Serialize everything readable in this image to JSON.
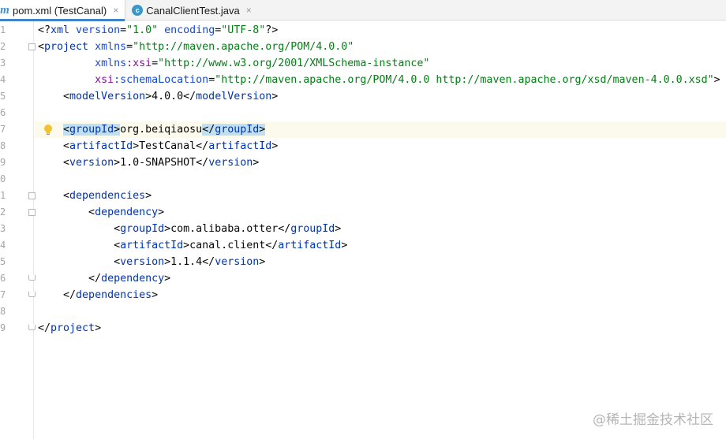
{
  "tabs": [
    {
      "label": "pom.xml (TestCanal)",
      "icon": "maven-file-icon",
      "close": "×",
      "active": true
    },
    {
      "label": "CanalClientTest.java",
      "icon": "java-class-icon",
      "close": "×",
      "active": false
    }
  ],
  "line_numbers": [
    "1",
    "2",
    "3",
    "4",
    "5",
    "6",
    "7",
    "8",
    "9",
    "0",
    "1",
    "2",
    "3",
    "4",
    "5",
    "6",
    "7",
    "8",
    "9"
  ],
  "code_lines": [
    {
      "tokens": [
        [
          "t-bracket",
          "<?"
        ],
        [
          "t-tag",
          "xml "
        ],
        [
          "t-attr",
          "version"
        ],
        [
          "t-bracket",
          "="
        ],
        [
          "t-val",
          "\"1.0\""
        ],
        [
          "t-bracket",
          " "
        ],
        [
          "t-attr",
          "encoding"
        ],
        [
          "t-bracket",
          "="
        ],
        [
          "t-val",
          "\"UTF-8\""
        ],
        [
          "t-bracket",
          "?>"
        ]
      ]
    },
    {
      "tokens": [
        [
          "t-bracket",
          "<"
        ],
        [
          "t-tag",
          "project "
        ],
        [
          "t-attr",
          "xmlns"
        ],
        [
          "t-bracket",
          "="
        ],
        [
          "t-val",
          "\"http://maven.apache.org/POM/4.0.0\""
        ]
      ]
    },
    {
      "tokens": [
        [
          "t-bracket",
          "         "
        ],
        [
          "t-attr",
          "xmlns"
        ],
        [
          "t-ns",
          ":xsi"
        ],
        [
          "t-bracket",
          "="
        ],
        [
          "t-val",
          "\"http://www.w3.org/2001/XMLSchema-instance\""
        ]
      ]
    },
    {
      "tokens": [
        [
          "t-bracket",
          "         "
        ],
        [
          "t-ns",
          "xsi"
        ],
        [
          "t-attr",
          ":schemaLocation"
        ],
        [
          "t-bracket",
          "="
        ],
        [
          "t-val",
          "\"http://maven.apache.org/POM/4.0.0 http://maven.apache.org/xsd/maven-4.0.0.xsd\""
        ],
        [
          "t-bracket",
          ">"
        ]
      ]
    },
    {
      "tokens": [
        [
          "t-bracket",
          "    <"
        ],
        [
          "t-tag",
          "modelVersion"
        ],
        [
          "t-bracket",
          ">"
        ],
        [
          "t-text",
          "4.0.0"
        ],
        [
          "t-bracket",
          "</"
        ],
        [
          "t-tag",
          "modelVersion"
        ],
        [
          "t-bracket",
          ">"
        ]
      ]
    },
    {
      "tokens": []
    },
    {
      "tokens": [
        [
          "t-bracket",
          "    "
        ],
        [
          "t-hl",
          "<"
        ],
        [
          "t-tag t-hl",
          "groupId"
        ],
        [
          "t-hl",
          ">"
        ],
        [
          "t-text",
          "org.beiqiaosu"
        ],
        [
          "t-hl",
          "</"
        ],
        [
          "t-tag t-hl",
          "groupId"
        ],
        [
          "t-hl",
          ">"
        ]
      ],
      "current": true,
      "bulb": true
    },
    {
      "tokens": [
        [
          "t-bracket",
          "    <"
        ],
        [
          "t-tag",
          "artifactId"
        ],
        [
          "t-bracket",
          ">"
        ],
        [
          "t-text",
          "TestCanal"
        ],
        [
          "t-bracket",
          "</"
        ],
        [
          "t-tag",
          "artifactId"
        ],
        [
          "t-bracket",
          ">"
        ]
      ]
    },
    {
      "tokens": [
        [
          "t-bracket",
          "    <"
        ],
        [
          "t-tag",
          "version"
        ],
        [
          "t-bracket",
          ">"
        ],
        [
          "t-text",
          "1.0-SNAPSHOT"
        ],
        [
          "t-bracket",
          "</"
        ],
        [
          "t-tag",
          "version"
        ],
        [
          "t-bracket",
          ">"
        ]
      ]
    },
    {
      "tokens": []
    },
    {
      "tokens": [
        [
          "t-bracket",
          "    <"
        ],
        [
          "t-tag",
          "dependencies"
        ],
        [
          "t-bracket",
          ">"
        ]
      ]
    },
    {
      "tokens": [
        [
          "t-bracket",
          "        <"
        ],
        [
          "t-tag",
          "dependency"
        ],
        [
          "t-bracket",
          ">"
        ]
      ]
    },
    {
      "tokens": [
        [
          "t-bracket",
          "            <"
        ],
        [
          "t-tag",
          "groupId"
        ],
        [
          "t-bracket",
          ">"
        ],
        [
          "t-text",
          "com.alibaba.otter"
        ],
        [
          "t-bracket",
          "</"
        ],
        [
          "t-tag",
          "groupId"
        ],
        [
          "t-bracket",
          ">"
        ]
      ]
    },
    {
      "tokens": [
        [
          "t-bracket",
          "            <"
        ],
        [
          "t-tag",
          "artifactId"
        ],
        [
          "t-bracket",
          ">"
        ],
        [
          "t-text",
          "canal.client"
        ],
        [
          "t-bracket",
          "</"
        ],
        [
          "t-tag",
          "artifactId"
        ],
        [
          "t-bracket",
          ">"
        ]
      ]
    },
    {
      "tokens": [
        [
          "t-bracket",
          "            <"
        ],
        [
          "t-tag",
          "version"
        ],
        [
          "t-bracket",
          ">"
        ],
        [
          "t-text",
          "1.1.4"
        ],
        [
          "t-bracket",
          "</"
        ],
        [
          "t-tag",
          "version"
        ],
        [
          "t-bracket",
          ">"
        ]
      ]
    },
    {
      "tokens": [
        [
          "t-bracket",
          "        </"
        ],
        [
          "t-tag",
          "dependency"
        ],
        [
          "t-bracket",
          ">"
        ]
      ]
    },
    {
      "tokens": [
        [
          "t-bracket",
          "    </"
        ],
        [
          "t-tag",
          "dependencies"
        ],
        [
          "t-bracket",
          ">"
        ]
      ]
    },
    {
      "tokens": []
    },
    {
      "tokens": [
        [
          "t-bracket",
          "</"
        ],
        [
          "t-tag",
          "project"
        ],
        [
          "t-bracket",
          ">"
        ]
      ]
    }
  ],
  "watermark": "@稀土掘金技术社区",
  "colors": {
    "tag": "#0033b3",
    "attribute": "#174ad4",
    "namespace": "#871094",
    "value": "#067d17",
    "current_line": "#fcfaed",
    "match_highlight": "#c0dff0",
    "active_tab_accent": "#4083c9"
  }
}
